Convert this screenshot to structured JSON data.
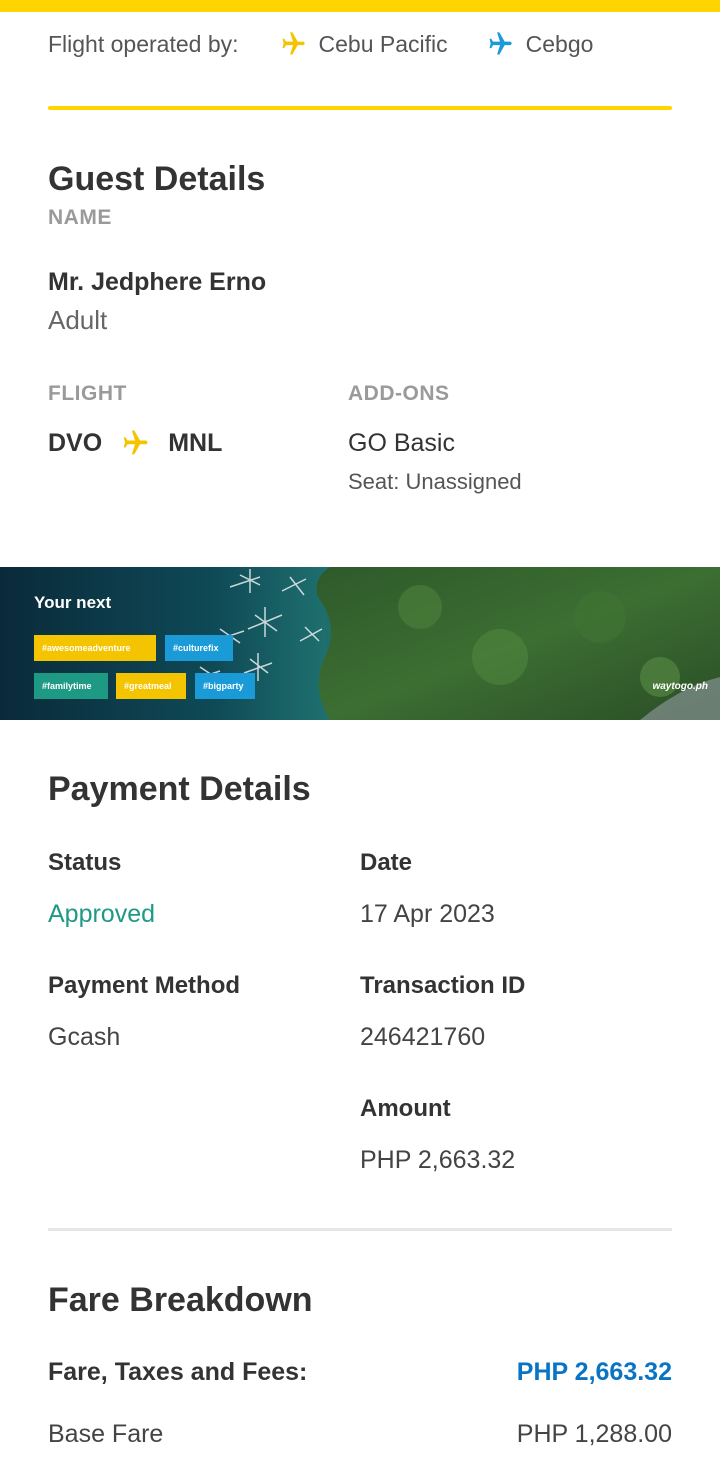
{
  "flight_operators": {
    "label": "Flight operated by:",
    "items": [
      {
        "name": "Cebu Pacific",
        "icon": "plane-icon",
        "color": "#F5C400"
      },
      {
        "name": "Cebgo",
        "icon": "plane-icon",
        "color": "#1A9BD8"
      }
    ]
  },
  "guest_details": {
    "title": "Guest Details",
    "name_label": "NAME",
    "name": "Mr. Jedphere Erno",
    "type": "Adult",
    "flight_label": "FLIGHT",
    "origin": "DVO",
    "destination": "MNL",
    "addons_label": "ADD-ONS",
    "addon": "GO Basic",
    "seat": "Seat: Unassigned"
  },
  "banner": {
    "heading": "Your next",
    "tags": [
      "#awesomeadventure",
      "#culturefix",
      "#familytime",
      "#greatmeal",
      "#bigparty"
    ],
    "site": "waytogo.ph"
  },
  "payment_details": {
    "title": "Payment Details",
    "status_label": "Status",
    "status": "Approved",
    "date_label": "Date",
    "date": "17 Apr 2023",
    "method_label": "Payment Method",
    "method": "Gcash",
    "transaction_label": "Transaction ID",
    "transaction_id": "246421760",
    "amount_label": "Amount",
    "amount": "PHP 2,663.32"
  },
  "fare_breakdown": {
    "title": "Fare Breakdown",
    "total_label": "Fare, Taxes and Fees:",
    "total": "PHP 2,663.32",
    "base_label": "Base Fare",
    "base": "PHP 1,288.00"
  },
  "colors": {
    "accent_yellow": "#FFD400",
    "approved_green": "#1E9A84",
    "link_blue": "#0A74C4"
  }
}
